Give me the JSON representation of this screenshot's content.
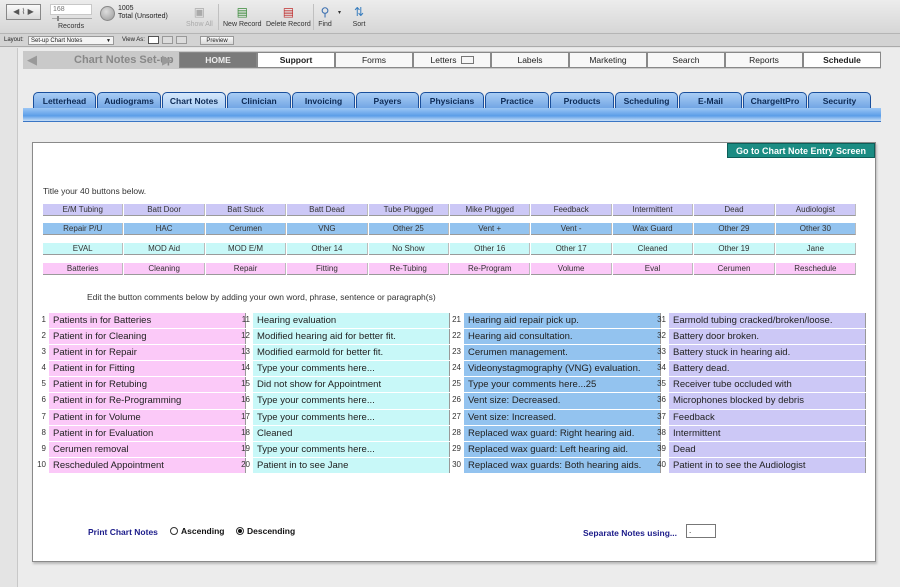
{
  "toolbar": {
    "record_value": "168",
    "records_label": "Records",
    "total_count": "1005",
    "total_label": "Total (Unsorted)",
    "show_all": "Show All",
    "new_record": "New Record",
    "delete_record": "Delete Record",
    "find": "Find",
    "sort": "Sort"
  },
  "layoutbar": {
    "layout_label": "Layout:",
    "layout_value": "Set-up Chart Notes",
    "view_as_label": "View As:",
    "preview": "Preview"
  },
  "nav": {
    "title": "Chart Notes Set-up",
    "buttons": [
      "HOME",
      "Support",
      "Forms",
      "Letters",
      "Labels",
      "Marketing",
      "Search",
      "Reports",
      "Schedule"
    ]
  },
  "tabs": [
    "Letterhead",
    "Audiograms",
    "Chart Notes",
    "Clinician",
    "Invoicing",
    "Payers",
    "Physicians",
    "Practice",
    "Products",
    "Scheduling",
    "E-Mail",
    "ChargeItPro",
    "Security"
  ],
  "active_tab": "Chart Notes",
  "goto_button": "Go to Chart Note Entry Screen",
  "title_hint": "Title your 40 buttons below.",
  "button_rows": [
    [
      "E/M Tubing",
      "Batt Door",
      "Batt Stuck",
      "Batt Dead",
      "Tube Plugged",
      "Mike Plugged",
      "Feedback",
      "Intermittent",
      "Dead",
      "Audiologist"
    ],
    [
      "Repair P/U",
      "HAC",
      "Cerumen",
      "VNG",
      "Other 25",
      "Vent +",
      "Vent -",
      "Wax Guard",
      "Other 29",
      "Other 30"
    ],
    [
      "EVAL",
      "MOD Aid",
      "MOD E/M",
      "Other 14",
      "No Show",
      "Other 16",
      "Other 17",
      "Cleaned",
      "Other 19",
      "Jane"
    ],
    [
      "Batteries",
      "Cleaning",
      "Repair",
      "Fitting",
      "Re-Tubing",
      "Re-Program",
      "Volume",
      "Eval",
      "Cerumen",
      "Reschedule"
    ]
  ],
  "edit_hint": "Edit the button comments below by adding your own word, phrase, sentence or paragraph(s)",
  "comments": [
    "Patients in for Batteries",
    "Patient in for Cleaning",
    "Patient in for Repair",
    "Patient in for Fitting",
    "Patient in for Retubing",
    "Patient in for Re-Programming",
    "Patient in for Volume",
    "Patient in for Evaluation",
    "Cerumen removal",
    "Rescheduled Appointment",
    "Hearing evaluation",
    "Modified hearing aid for better fit.",
    "Modified earmold for better fit.",
    "Type your comments here...",
    "Did not show for Appointment",
    "Type your comments here...",
    "Type your comments here...",
    "Cleaned",
    "Type your comments here...",
    "Patient in to see Jane",
    "Hearing aid repair pick up.",
    "Hearing aid consultation.",
    "Cerumen management.",
    "Videonystagmography (VNG) evaluation.",
    "Type your comments here...25",
    "Vent size: Decreased.",
    "Vent size: Increased.",
    "Replaced wax guard: Right hearing aid.",
    "Replaced wax guard: Left hearing aid.",
    "Replaced wax guards: Both hearing aids.",
    "Earmold tubing cracked/broken/loose.",
    "Battery door broken.",
    "Battery stuck in hearing aid.",
    "Battery dead.",
    "Receiver tube occluded with",
    "Microphones blocked by debris",
    "Feedback",
    "Intermittent",
    "Dead",
    "Patient in to see the Audiologist"
  ],
  "print": {
    "label": "Print Chart  Notes",
    "ascending": "Ascending",
    "descending": "Descending",
    "selected": "Descending"
  },
  "separate": {
    "label": "Separate Notes using...",
    "value": "."
  },
  "colors": {
    "accent_teal": "#1c8c83",
    "tab_blue": "#6fa3e3",
    "purple_row": "#ccc8f6",
    "blue_row": "#93c3ef",
    "cyan_row": "#c8f8f8",
    "pink_row": "#fbc9f8"
  }
}
